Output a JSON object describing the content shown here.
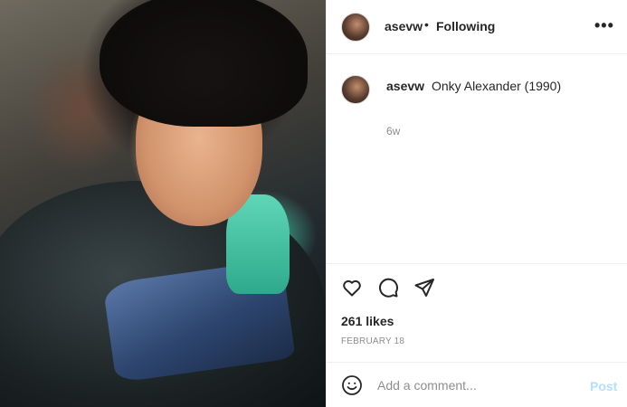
{
  "post": {
    "username": "asevw",
    "follow_label": "Following",
    "separator": "•",
    "more_label": "•••",
    "caption_user": "asevw",
    "caption_text": "Onky Alexander (1990)",
    "time_ago": "6w",
    "likes": "261 likes",
    "date": "FEBRUARY 18"
  },
  "comment": {
    "placeholder": "Add a comment...",
    "post_label": "Post"
  },
  "icons": {
    "like": "heart-icon",
    "comment": "comment-icon",
    "share": "paper-plane-icon",
    "emoji": "smiley-icon",
    "more": "more-options-icon"
  },
  "colors": {
    "text": "#262626",
    "muted": "#8e8e8e",
    "post_disabled": "#b2dffc",
    "divider": "#efefef"
  }
}
